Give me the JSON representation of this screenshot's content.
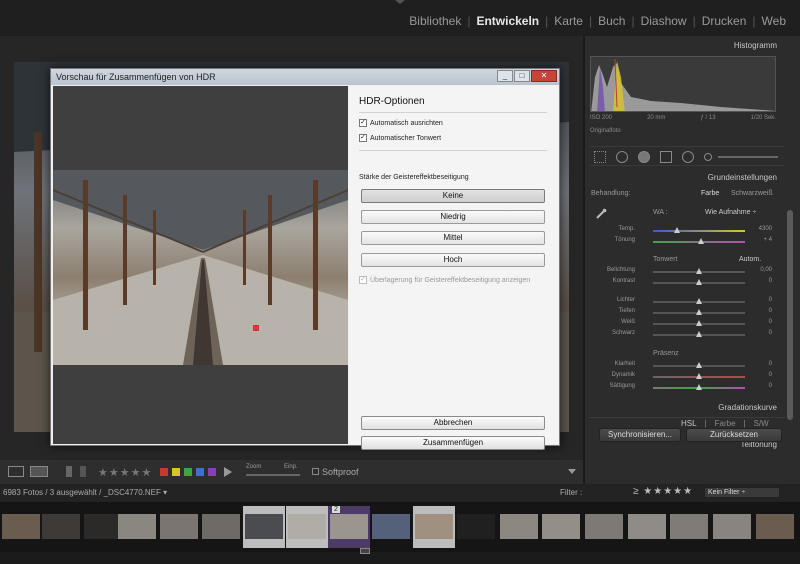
{
  "modules": [
    "Bibliothek",
    "Entwickeln",
    "Karte",
    "Buch",
    "Diashow",
    "Drucken",
    "Web"
  ],
  "active_module": "Entwickeln",
  "dialog": {
    "title": "Vorschau für Zusammenfügen von HDR",
    "options_heading": "HDR-Optionen",
    "auto_align": "Automatisch ausrichten",
    "auto_tone": "Automatischer Tonwert",
    "ghost_label": "Stärke der Geistereffektbeseitigung",
    "ghost_options": [
      "Keine",
      "Niedrig",
      "Mittel",
      "Hoch"
    ],
    "ghost_selected": "Keine",
    "overlay_label": "Überlagerung für Geistereffektbeseitigung anzeigen",
    "cancel": "Abbrechen",
    "merge": "Zusammenfügen",
    "win_buttons": [
      "_",
      "□",
      "✕"
    ]
  },
  "right_panel": {
    "histogram_title": "Histogramm",
    "meta": [
      "ISO 200",
      "20 mm",
      "ƒ / 13",
      "1/20 Sek."
    ],
    "original_photo": "Originalfoto",
    "basic_title": "Grundeinstellungen",
    "treatment_label": "Behandlung:",
    "treatment_color": "Farbe",
    "treatment_bw": "Schwarzweiß",
    "wb_label": "WA :",
    "wb_value": "Wie Aufnahme ÷",
    "temp": {
      "label": "Temp.",
      "value": "4300"
    },
    "tint": {
      "label": "Tönung",
      "value": "+ 4"
    },
    "tone_label": "Tonwert",
    "auto_label": "Autom.",
    "sliders": [
      {
        "label": "Belichtung",
        "value": "0,00"
      },
      {
        "label": "Kontrast",
        "value": "0"
      },
      {
        "label": "Lichter",
        "value": "0"
      },
      {
        "label": "Tiefen",
        "value": "0"
      },
      {
        "label": "Weiß",
        "value": "0"
      },
      {
        "label": "Schwarz",
        "value": "0"
      }
    ],
    "presence_label": "Präsenz",
    "presence_sliders": [
      {
        "label": "Klarheit",
        "value": "0"
      },
      {
        "label": "Dynamik",
        "value": "0"
      },
      {
        "label": "Sättigung",
        "value": "0"
      }
    ],
    "tone_curve": "Gradationskurve",
    "hsl_tabs": [
      "HSL",
      "Farbe",
      "S/W"
    ],
    "split_toning": "Teiltonung",
    "sync_button": "Synchronisieren...",
    "reset_button": "Zurücksetzen"
  },
  "toolbar": {
    "stars": "★★★★★",
    "zoom_label": "Zoom",
    "fit_label": "Einp.",
    "softproof": "Softproof",
    "label_colors": [
      "#c8392e",
      "#d8c62a",
      "#3fa543",
      "#3f6fd1",
      "#8a3fb8"
    ]
  },
  "filmstrip": {
    "count": "6983 Fotos / 3 ausgewählt / _DSC4770.NEF ▾",
    "filter_label": "Filter :",
    "filter_stars": "≥ ★★★★★",
    "filter_select": "Kein Filter ÷",
    "badge": "2"
  }
}
